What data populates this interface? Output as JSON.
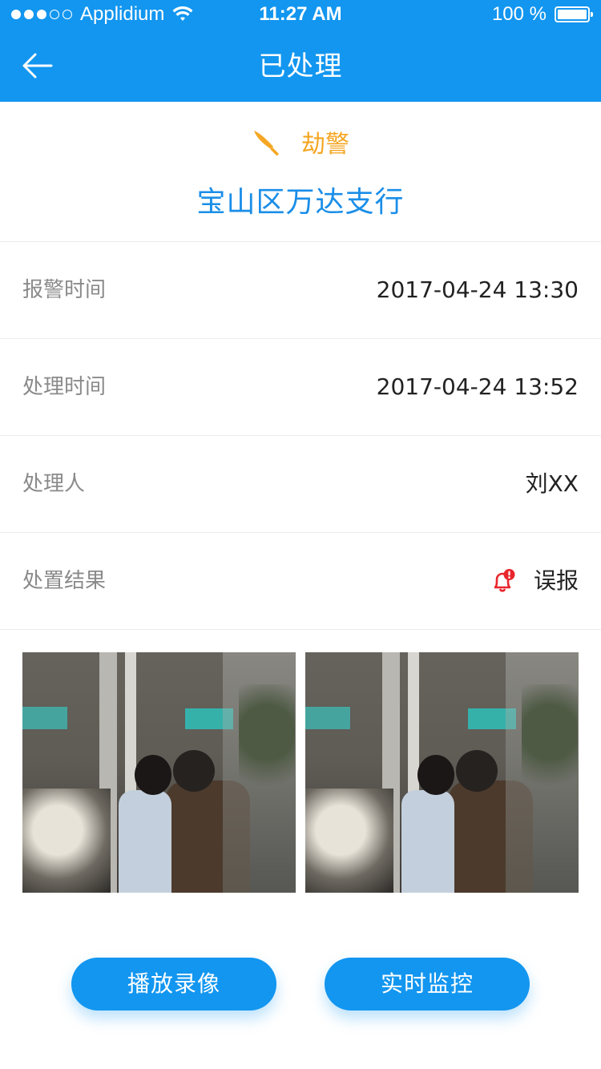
{
  "status_bar": {
    "carrier": "Applidium",
    "time": "11:27 AM",
    "battery": "100 %"
  },
  "nav": {
    "title": "已处理"
  },
  "alarm": {
    "type": "劫警",
    "branch": "宝山区万达支行"
  },
  "details": [
    {
      "label": "报警时间",
      "value": "2017-04-24 13:30"
    },
    {
      "label": "处理时间",
      "value": "2017-04-24 13:52"
    },
    {
      "label": "处理人",
      "value": "刘XX"
    },
    {
      "label": "处置结果",
      "value": "误报"
    }
  ],
  "actions": {
    "play_recording": "播放录像",
    "live_monitor": "实时监控"
  },
  "colors": {
    "primary": "#1296f0",
    "alarm_type": "#f5a623",
    "branch_text": "#1a8ee8",
    "result_bell": "#e8262c"
  },
  "icons": {
    "back": "arrow-left-icon",
    "alarm_type": "knife-icon",
    "result": "bell-alert-icon",
    "wifi": "wifi-icon",
    "battery": "battery-icon"
  }
}
